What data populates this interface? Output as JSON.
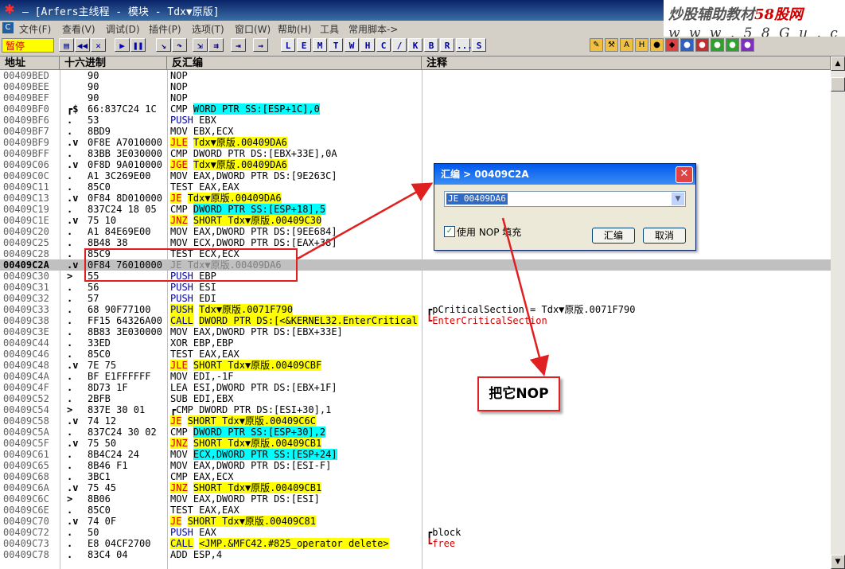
{
  "window": {
    "title": "– [Arfers主线程 - 模块 - Tdx▼原版]",
    "watermark_line1": "炒股辅助教材",
    "watermark_line1_red": "58股网",
    "watermark_line2": "w w w . 5 8 G u . c o m"
  },
  "menu": {
    "items": [
      "文件(F)",
      "查看(V)",
      "调试(D)",
      "插件(P)",
      "选项(T)",
      "窗口(W)",
      "帮助(H)",
      "工具",
      "常用脚本->"
    ]
  },
  "toolbar": {
    "status": "暂停",
    "letter_buttons": [
      "L",
      "E",
      "M",
      "T",
      "W",
      "H",
      "C",
      "/",
      "K",
      "B",
      "R",
      "...",
      "S"
    ]
  },
  "columns": {
    "address": "地址",
    "hex": "十六进制",
    "disasm": "反汇编",
    "comment": "注释"
  },
  "rows": [
    {
      "addr": "00409BED",
      "mark": "",
      "hex": "90",
      "mn": "NOP",
      "ops": ""
    },
    {
      "addr": "00409BEE",
      "mark": "",
      "hex": "90",
      "mn": "NOP",
      "ops": ""
    },
    {
      "addr": "00409BEF",
      "mark": "",
      "hex": "90",
      "mn": "NOP",
      "ops": ""
    },
    {
      "addr": "00409BF0",
      "mark": "┏$",
      "hex": "66:837C24 1C",
      "mn": "CMP",
      "ops": "WORD PTR SS:[ESP+1C],0"
    },
    {
      "addr": "00409BF6",
      "mark": ".",
      "hex": "53",
      "mn": "PUSH",
      "ops": "EBX"
    },
    {
      "addr": "00409BF7",
      "mark": ".",
      "hex": "8BD9",
      "mn": "MOV",
      "ops": "EBX,ECX"
    },
    {
      "addr": "00409BF9",
      "mark": ".v",
      "hex": "0F8E A7010000",
      "mn": "JLE",
      "ops": "Tdx▼原版.00409DA6"
    },
    {
      "addr": "00409BFF",
      "mark": ".",
      "hex": "83BB 3E030000",
      "mn": "CMP",
      "ops": "DWORD PTR DS:[EBX+33E],0A"
    },
    {
      "addr": "00409C06",
      "mark": ".v",
      "hex": "0F8D 9A010000",
      "mn": "JGE",
      "ops": "Tdx▼原版.00409DA6"
    },
    {
      "addr": "00409C0C",
      "mark": ".",
      "hex": "A1 3C269E00",
      "mn": "MOV",
      "ops": "EAX,DWORD PTR DS:[9E263C]"
    },
    {
      "addr": "00409C11",
      "mark": ".",
      "hex": "85C0",
      "mn": "TEST",
      "ops": "EAX,EAX"
    },
    {
      "addr": "00409C13",
      "mark": ".v",
      "hex": "0F84 8D010000",
      "mn": "JE",
      "ops": "Tdx▼原版.00409DA6"
    },
    {
      "addr": "00409C19",
      "mark": ".",
      "hex": "837C24 18 05",
      "mn": "CMP",
      "ops": "DWORD PTR SS:[ESP+18],5"
    },
    {
      "addr": "00409C1E",
      "mark": ".v",
      "hex": "75 10",
      "mn": "JNZ",
      "ops": "SHORT Tdx▼原版.00409C30"
    },
    {
      "addr": "00409C20",
      "mark": ".",
      "hex": "A1 84E69E00",
      "mn": "MOV",
      "ops": "EAX,DWORD PTR DS:[9EE684]"
    },
    {
      "addr": "00409C25",
      "mark": ".",
      "hex": "8B48 38",
      "mn": "MOV",
      "ops": "ECX,DWORD PTR DS:[EAX+38]"
    },
    {
      "addr": "00409C28",
      "mark": ".",
      "hex": "85C9",
      "mn": "TEST",
      "ops": "ECX,ECX"
    },
    {
      "addr": "00409C2A",
      "mark": ".v",
      "hex": "0F84 76010000",
      "mn": "JE",
      "ops": "Tdx▼原版.00409DA6"
    },
    {
      "addr": "00409C30",
      "mark": ">",
      "hex": "55",
      "mn": "PUSH",
      "ops": "EBP"
    },
    {
      "addr": "00409C31",
      "mark": ".",
      "hex": "56",
      "mn": "PUSH",
      "ops": "ESI"
    },
    {
      "addr": "00409C32",
      "mark": ".",
      "hex": "57",
      "mn": "PUSH",
      "ops": "EDI"
    },
    {
      "addr": "00409C33",
      "mark": ".",
      "hex": "68 90F77100",
      "mn": "PUSH",
      "ops": "Tdx▼原版.0071F790",
      "cmt": "┏pCriticalSection = Tdx▼原版.0071F790"
    },
    {
      "addr": "00409C38",
      "mark": ".",
      "hex": "FF15 64326A00",
      "mn": "CALL",
      "ops": "DWORD PTR DS:[<&KERNEL32.EnterCritical",
      "cmt": "┗EnterCriticalSection"
    },
    {
      "addr": "00409C3E",
      "mark": ".",
      "hex": "8B83 3E030000",
      "mn": "MOV",
      "ops": "EAX,DWORD PTR DS:[EBX+33E]"
    },
    {
      "addr": "00409C44",
      "mark": ".",
      "hex": "33ED",
      "mn": "XOR",
      "ops": "EBP,EBP"
    },
    {
      "addr": "00409C46",
      "mark": ".",
      "hex": "85C0",
      "mn": "TEST",
      "ops": "EAX,EAX"
    },
    {
      "addr": "00409C48",
      "mark": ".v",
      "hex": "7E 75",
      "mn": "JLE",
      "ops": "SHORT Tdx▼原版.00409CBF"
    },
    {
      "addr": "00409C4A",
      "mark": ".",
      "hex": "BF E1FFFFFF",
      "mn": "MOV",
      "ops": "EDI,-1F"
    },
    {
      "addr": "00409C4F",
      "mark": ".",
      "hex": "8D73 1F",
      "mn": "LEA",
      "ops": "ESI,DWORD PTR DS:[EBX+1F]"
    },
    {
      "addr": "00409C52",
      "mark": ".",
      "hex": "2BFB",
      "mn": "SUB",
      "ops": "EDI,EBX"
    },
    {
      "addr": "00409C54",
      "mark": ">",
      "hex": "837E 30 01",
      "mn": "┏CMP",
      "ops": "DWORD PTR DS:[ESI+30],1"
    },
    {
      "addr": "00409C58",
      "mark": ".v",
      "hex": "74 12",
      "mn": "JE",
      "ops": "SHORT Tdx▼原版.00409C6C"
    },
    {
      "addr": "00409C5A",
      "mark": ".",
      "hex": "837C24 30 02",
      "mn": "CMP",
      "ops": "DWORD PTR SS:[ESP+30],2"
    },
    {
      "addr": "00409C5F",
      "mark": ".v",
      "hex": "75 50",
      "mn": "JNZ",
      "ops": "SHORT Tdx▼原版.00409CB1"
    },
    {
      "addr": "00409C61",
      "mark": ".",
      "hex": "8B4C24 24",
      "mn": "MOV",
      "ops": "ECX,DWORD PTR SS:[ESP+24]"
    },
    {
      "addr": "00409C65",
      "mark": ".",
      "hex": "8B46 F1",
      "mn": "MOV",
      "ops": "EAX,DWORD PTR DS:[ESI-F]"
    },
    {
      "addr": "00409C68",
      "mark": ".",
      "hex": "3BC1",
      "mn": "CMP",
      "ops": "EAX,ECX"
    },
    {
      "addr": "00409C6A",
      "mark": ".v",
      "hex": "75 45",
      "mn": "JNZ",
      "ops": "SHORT Tdx▼原版.00409CB1"
    },
    {
      "addr": "00409C6C",
      "mark": ">",
      "hex": "8B06",
      "mn": "MOV",
      "ops": "EAX,DWORD PTR DS:[ESI]"
    },
    {
      "addr": "00409C6E",
      "mark": ".",
      "hex": "85C0",
      "mn": "TEST",
      "ops": "EAX,EAX"
    },
    {
      "addr": "00409C70",
      "mark": ".v",
      "hex": "74 0F",
      "mn": "JE",
      "ops": "SHORT Tdx▼原版.00409C81"
    },
    {
      "addr": "00409C72",
      "mark": ".",
      "hex": "50",
      "mn": "PUSH",
      "ops": "EAX",
      "cmt": "┏block"
    },
    {
      "addr": "00409C73",
      "mark": ".",
      "hex": "E8 04CF2700",
      "mn": "CALL",
      "ops": "<JMP.&MFC42.#825_operator delete>",
      "cmt": "┗free"
    },
    {
      "addr": "00409C78",
      "mark": ".",
      "hex": "83C4 04",
      "mn": "ADD",
      "ops": "ESP,4"
    }
  ],
  "dialog": {
    "title": "汇编        > 00409C2A",
    "input_value": "JE 00409DA6",
    "checkbox_label": "使用 NOP 填充",
    "assemble_button": "汇编",
    "cancel_button": "取消"
  },
  "callout": {
    "text": "把它NOP"
  },
  "colors": {
    "highlight_yellow": "#ffff00",
    "highlight_cyan": "#00ffff",
    "annotation_red": "#e02020",
    "selected_row": "#c0c0c0"
  }
}
